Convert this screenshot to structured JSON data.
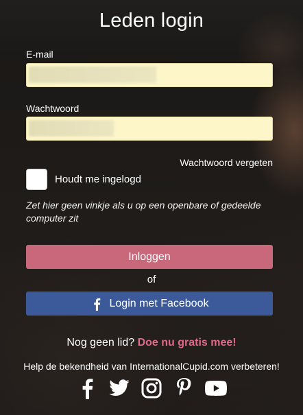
{
  "page": {
    "title": "Leden login"
  },
  "form": {
    "email_label": "E-mail",
    "email_value": "",
    "password_label": "Wachtwoord",
    "password_value": "",
    "forgot_link": "Wachtwoord vergeten",
    "remember_label": "Houdt me ingelogd",
    "remember_checked": false,
    "hint": "Zet hier geen vinkje als u op een openbare of gedeelde computer zit",
    "login_button": "Inloggen",
    "or_text": "of",
    "facebook_button": "Login met Facebook"
  },
  "signup": {
    "prompt": "Nog geen lid?",
    "link": "Doe nu gratis mee!"
  },
  "footer": {
    "help_text": "Help de bekendheid van InternationalCupid.com verbeteren!",
    "social_icons": [
      "facebook-icon",
      "twitter-icon",
      "instagram-icon",
      "pinterest-icon",
      "youtube-icon"
    ]
  },
  "colors": {
    "login_button": "#c9687b",
    "facebook_button": "#3c5a99",
    "input_background": "#fdf6c9",
    "signup_link": "#e06a85"
  }
}
